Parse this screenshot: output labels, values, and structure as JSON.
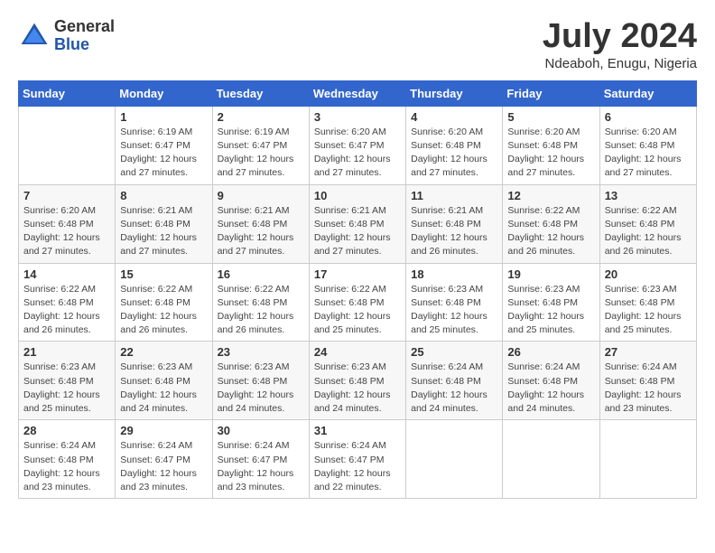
{
  "header": {
    "logo": {
      "general": "General",
      "blue": "Blue"
    },
    "title": "July 2024",
    "location": "Ndeaboh, Enugu, Nigeria"
  },
  "calendar": {
    "weekdays": [
      "Sunday",
      "Monday",
      "Tuesday",
      "Wednesday",
      "Thursday",
      "Friday",
      "Saturday"
    ],
    "weeks": [
      [
        {
          "day": "",
          "sunrise": "",
          "sunset": "",
          "daylight": ""
        },
        {
          "day": "1",
          "sunrise": "Sunrise: 6:19 AM",
          "sunset": "Sunset: 6:47 PM",
          "daylight": "Daylight: 12 hours and 27 minutes."
        },
        {
          "day": "2",
          "sunrise": "Sunrise: 6:19 AM",
          "sunset": "Sunset: 6:47 PM",
          "daylight": "Daylight: 12 hours and 27 minutes."
        },
        {
          "day": "3",
          "sunrise": "Sunrise: 6:20 AM",
          "sunset": "Sunset: 6:47 PM",
          "daylight": "Daylight: 12 hours and 27 minutes."
        },
        {
          "day": "4",
          "sunrise": "Sunrise: 6:20 AM",
          "sunset": "Sunset: 6:48 PM",
          "daylight": "Daylight: 12 hours and 27 minutes."
        },
        {
          "day": "5",
          "sunrise": "Sunrise: 6:20 AM",
          "sunset": "Sunset: 6:48 PM",
          "daylight": "Daylight: 12 hours and 27 minutes."
        },
        {
          "day": "6",
          "sunrise": "Sunrise: 6:20 AM",
          "sunset": "Sunset: 6:48 PM",
          "daylight": "Daylight: 12 hours and 27 minutes."
        }
      ],
      [
        {
          "day": "7",
          "sunrise": "Sunrise: 6:20 AM",
          "sunset": "Sunset: 6:48 PM",
          "daylight": "Daylight: 12 hours and 27 minutes."
        },
        {
          "day": "8",
          "sunrise": "Sunrise: 6:21 AM",
          "sunset": "Sunset: 6:48 PM",
          "daylight": "Daylight: 12 hours and 27 minutes."
        },
        {
          "day": "9",
          "sunrise": "Sunrise: 6:21 AM",
          "sunset": "Sunset: 6:48 PM",
          "daylight": "Daylight: 12 hours and 27 minutes."
        },
        {
          "day": "10",
          "sunrise": "Sunrise: 6:21 AM",
          "sunset": "Sunset: 6:48 PM",
          "daylight": "Daylight: 12 hours and 27 minutes."
        },
        {
          "day": "11",
          "sunrise": "Sunrise: 6:21 AM",
          "sunset": "Sunset: 6:48 PM",
          "daylight": "Daylight: 12 hours and 26 minutes."
        },
        {
          "day": "12",
          "sunrise": "Sunrise: 6:22 AM",
          "sunset": "Sunset: 6:48 PM",
          "daylight": "Daylight: 12 hours and 26 minutes."
        },
        {
          "day": "13",
          "sunrise": "Sunrise: 6:22 AM",
          "sunset": "Sunset: 6:48 PM",
          "daylight": "Daylight: 12 hours and 26 minutes."
        }
      ],
      [
        {
          "day": "14",
          "sunrise": "Sunrise: 6:22 AM",
          "sunset": "Sunset: 6:48 PM",
          "daylight": "Daylight: 12 hours and 26 minutes."
        },
        {
          "day": "15",
          "sunrise": "Sunrise: 6:22 AM",
          "sunset": "Sunset: 6:48 PM",
          "daylight": "Daylight: 12 hours and 26 minutes."
        },
        {
          "day": "16",
          "sunrise": "Sunrise: 6:22 AM",
          "sunset": "Sunset: 6:48 PM",
          "daylight": "Daylight: 12 hours and 26 minutes."
        },
        {
          "day": "17",
          "sunrise": "Sunrise: 6:22 AM",
          "sunset": "Sunset: 6:48 PM",
          "daylight": "Daylight: 12 hours and 25 minutes."
        },
        {
          "day": "18",
          "sunrise": "Sunrise: 6:23 AM",
          "sunset": "Sunset: 6:48 PM",
          "daylight": "Daylight: 12 hours and 25 minutes."
        },
        {
          "day": "19",
          "sunrise": "Sunrise: 6:23 AM",
          "sunset": "Sunset: 6:48 PM",
          "daylight": "Daylight: 12 hours and 25 minutes."
        },
        {
          "day": "20",
          "sunrise": "Sunrise: 6:23 AM",
          "sunset": "Sunset: 6:48 PM",
          "daylight": "Daylight: 12 hours and 25 minutes."
        }
      ],
      [
        {
          "day": "21",
          "sunrise": "Sunrise: 6:23 AM",
          "sunset": "Sunset: 6:48 PM",
          "daylight": "Daylight: 12 hours and 25 minutes."
        },
        {
          "day": "22",
          "sunrise": "Sunrise: 6:23 AM",
          "sunset": "Sunset: 6:48 PM",
          "daylight": "Daylight: 12 hours and 24 minutes."
        },
        {
          "day": "23",
          "sunrise": "Sunrise: 6:23 AM",
          "sunset": "Sunset: 6:48 PM",
          "daylight": "Daylight: 12 hours and 24 minutes."
        },
        {
          "day": "24",
          "sunrise": "Sunrise: 6:23 AM",
          "sunset": "Sunset: 6:48 PM",
          "daylight": "Daylight: 12 hours and 24 minutes."
        },
        {
          "day": "25",
          "sunrise": "Sunrise: 6:24 AM",
          "sunset": "Sunset: 6:48 PM",
          "daylight": "Daylight: 12 hours and 24 minutes."
        },
        {
          "day": "26",
          "sunrise": "Sunrise: 6:24 AM",
          "sunset": "Sunset: 6:48 PM",
          "daylight": "Daylight: 12 hours and 24 minutes."
        },
        {
          "day": "27",
          "sunrise": "Sunrise: 6:24 AM",
          "sunset": "Sunset: 6:48 PM",
          "daylight": "Daylight: 12 hours and 23 minutes."
        }
      ],
      [
        {
          "day": "28",
          "sunrise": "Sunrise: 6:24 AM",
          "sunset": "Sunset: 6:48 PM",
          "daylight": "Daylight: 12 hours and 23 minutes."
        },
        {
          "day": "29",
          "sunrise": "Sunrise: 6:24 AM",
          "sunset": "Sunset: 6:47 PM",
          "daylight": "Daylight: 12 hours and 23 minutes."
        },
        {
          "day": "30",
          "sunrise": "Sunrise: 6:24 AM",
          "sunset": "Sunset: 6:47 PM",
          "daylight": "Daylight: 12 hours and 23 minutes."
        },
        {
          "day": "31",
          "sunrise": "Sunrise: 6:24 AM",
          "sunset": "Sunset: 6:47 PM",
          "daylight": "Daylight: 12 hours and 22 minutes."
        },
        {
          "day": "",
          "sunrise": "",
          "sunset": "",
          "daylight": ""
        },
        {
          "day": "",
          "sunrise": "",
          "sunset": "",
          "daylight": ""
        },
        {
          "day": "",
          "sunrise": "",
          "sunset": "",
          "daylight": ""
        }
      ]
    ]
  }
}
